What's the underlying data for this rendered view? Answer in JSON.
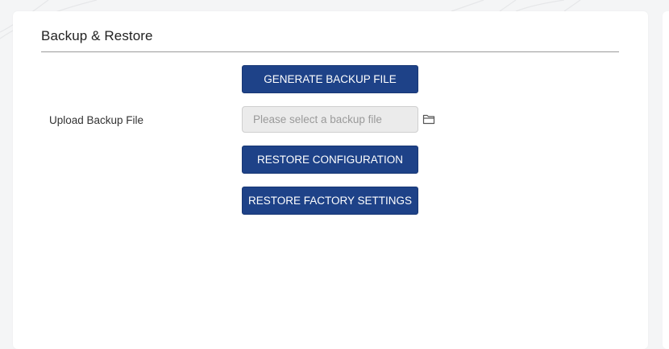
{
  "panel": {
    "title": "Backup & Restore"
  },
  "actions": {
    "generate_label": "GENERATE BACKUP FILE",
    "restore_config_label": "RESTORE CONFIGURATION",
    "restore_factory_label": "RESTORE FACTORY SETTINGS"
  },
  "upload": {
    "label": "Upload Backup File",
    "value": "",
    "placeholder": "Please select a backup file",
    "icon": "folder-icon"
  },
  "colors": {
    "button_bg": "#1e4288",
    "page_bg": "#f4f5f6",
    "panel_bg": "#ffffff"
  }
}
